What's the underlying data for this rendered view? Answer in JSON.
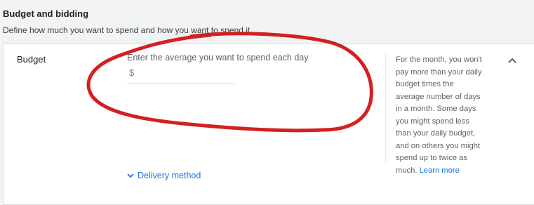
{
  "section": {
    "title": "Budget and bidding",
    "subtitle": "Define how much you want to spend and how you want to spend it"
  },
  "budget": {
    "label": "Budget",
    "field_label": "Enter the average you want to spend each day",
    "currency_symbol": "$",
    "value": ""
  },
  "help": {
    "text": "For the month, you won't pay more than your daily budget times the average number of days in a month. Some days you might spend less than your daily budget, and on others you might spend up to twice as much.",
    "link_text": "Learn more"
  },
  "icons": {
    "collapse": "chevron-up-icon",
    "expand": "chevron-down-icon"
  },
  "delivery": {
    "label": "Delivery method"
  },
  "colors": {
    "accent": "#1a73e8",
    "annotation": "#d32020"
  }
}
